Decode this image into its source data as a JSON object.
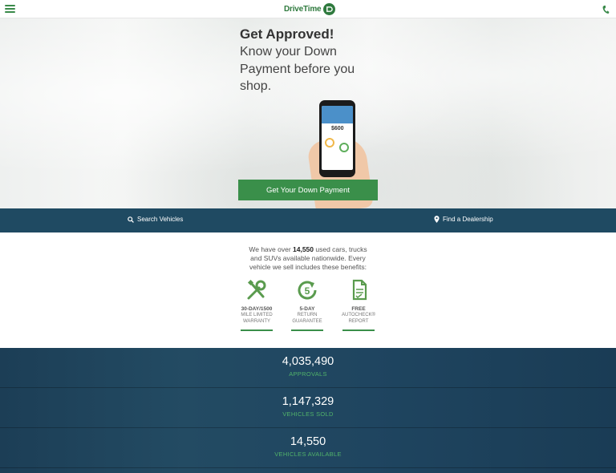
{
  "header": {
    "logo_text": "DriveTime",
    "logo_mark": "DT",
    "menu_icon": "hamburger-menu-icon",
    "phone_icon": "phone-icon"
  },
  "hero": {
    "title": "Get Approved!",
    "subtitle": "Know your Down Payment before you shop.",
    "phone_amount": "$600",
    "cta_label": "Get Your Down Payment"
  },
  "nav": {
    "search_label": "Search Vehicles",
    "dealer_label": "Find a Dealership"
  },
  "benefits": {
    "intro_prefix": "We have over ",
    "intro_count": "14,550",
    "intro_suffix": " used cars, trucks and SUVs available nationwide. Every vehicle we sell includes these benefits:",
    "items": [
      {
        "icon": "wrench-screwdriver-icon",
        "title": "30-DAY/1500",
        "desc": "MILE LIMITED WARRANTY"
      },
      {
        "icon": "five-day-return-icon",
        "title": "5-DAY",
        "desc": "RETURN GUARANTEE"
      },
      {
        "icon": "report-document-icon",
        "title": "FREE",
        "desc": "AUTOCHECK® REPORT"
      }
    ]
  },
  "stats": [
    {
      "value": "4,035,490",
      "label": "APPROVALS"
    },
    {
      "value": "1,147,329",
      "label": "VEHICLES SOLD"
    },
    {
      "value": "14,550",
      "label": "VEHICLES AVAILABLE"
    }
  ],
  "colors": {
    "brand_green": "#3a8f4a",
    "nav_blue": "#1f4a62",
    "stat_green": "#51b36a"
  }
}
